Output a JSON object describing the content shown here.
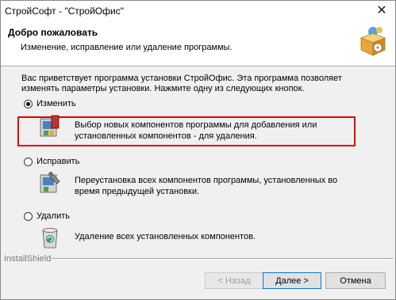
{
  "window": {
    "title": "СтройСофт - \"СтройОфис\"",
    "close_glyph": "✕"
  },
  "header": {
    "title": "Добро пожаловать",
    "subtitle": "Изменение, исправление или удаление программы."
  },
  "intro": "Вас приветствует программа установки СтройОфис. Эта программа позволяет изменять параметры установки. Нажмите одну из следующих кнопок.",
  "options": [
    {
      "label": "Изменить",
      "selected": true,
      "icon": "modify-icon",
      "description": "Выбор новых компонентов программы для добавления или установленных компонентов - для удаления."
    },
    {
      "label": "Исправить",
      "selected": false,
      "icon": "repair-icon",
      "description": "Переустановка всех компонентов программы, установленных во время предыдущей установки."
    },
    {
      "label": "Удалить",
      "selected": false,
      "icon": "remove-icon",
      "description": "Удаление всех установленных компонентов."
    }
  ],
  "footer": {
    "brand": "InstallShield"
  },
  "buttons": {
    "back": "< Назад",
    "next": "Далее >",
    "cancel": "Отмена"
  },
  "colors": {
    "highlight": "#e00000",
    "background": "#f0f0f0"
  }
}
